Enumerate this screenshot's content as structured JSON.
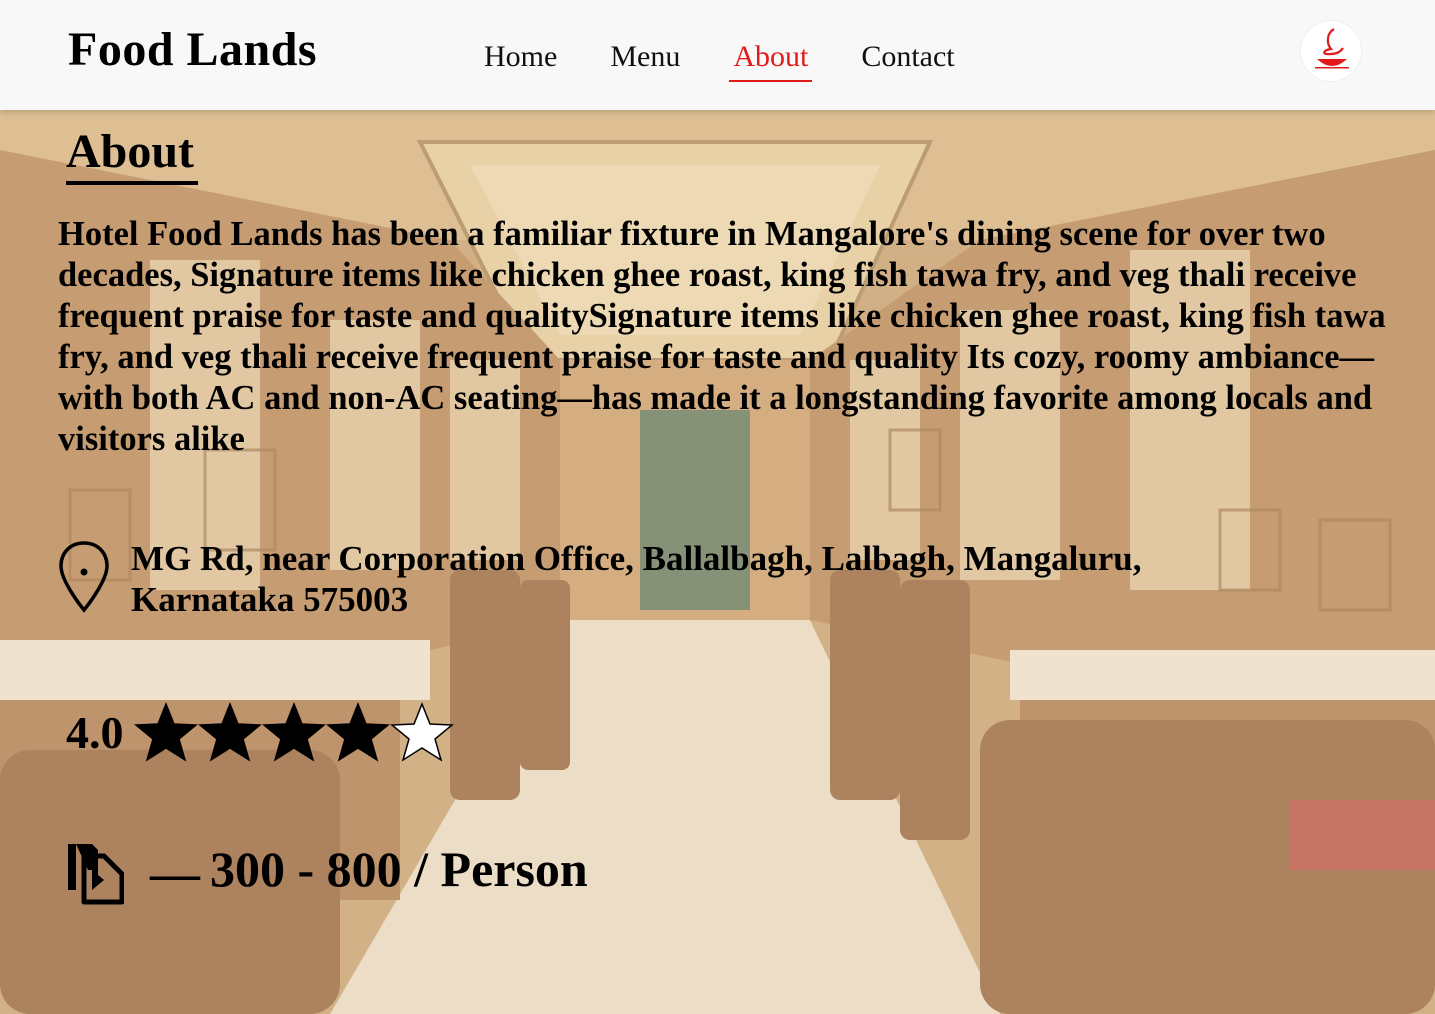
{
  "header": {
    "brand": "Food Lands",
    "nav": [
      {
        "label": "Home",
        "active": false
      },
      {
        "label": "Menu",
        "active": false
      },
      {
        "label": "About",
        "active": true
      },
      {
        "label": "Contact",
        "active": false
      }
    ],
    "logo_text": "Food Lands"
  },
  "about": {
    "title": "About",
    "description": "Hotel Food Lands has been a familiar fixture in Mangalore's dining scene for over two decades, Signature items like chicken ghee roast, king fish tawa fry, and veg thali receive frequent praise for taste and qualitySignature items like chicken ghee roast, king fish tawa fry, and veg thali receive frequent praise for taste and quality Its cozy, roomy ambiance—with both AC and non-AC seating—has made it a longstanding favorite among locals and visitors alike",
    "address": "MG Rd, near Corporation Office, Ballalbagh, Lalbagh, Mangaluru, Karnataka 575003",
    "rating_value": "4.0",
    "rating_stars": 4,
    "rating_max": 5,
    "price_dash": "—",
    "price": "300 - 800 / Person"
  },
  "icons": {
    "location": "map-pin-icon",
    "price": "document-icon",
    "star": "star-icon"
  },
  "colors": {
    "accent": "#e11b1b",
    "header_bg": "#f8f8f8",
    "text": "#000000"
  }
}
